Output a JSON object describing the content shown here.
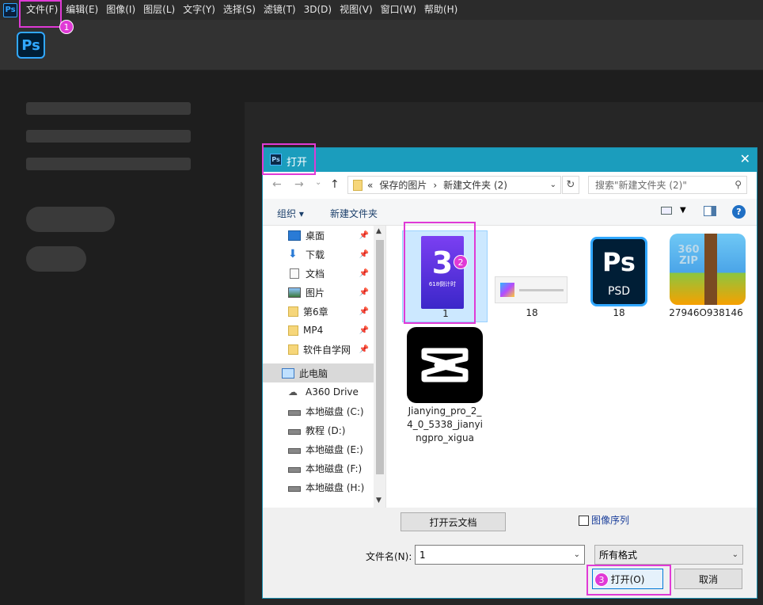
{
  "app": {
    "icon_text": "Ps",
    "menu": [
      "文件(F)",
      "编辑(E)",
      "图像(I)",
      "图层(L)",
      "文字(Y)",
      "选择(S)",
      "滤镜(T)",
      "3D(D)",
      "视图(V)",
      "窗口(W)",
      "帮助(H)"
    ],
    "logo_text": "Ps"
  },
  "dialog": {
    "title": "打开",
    "title_icon": "Ps",
    "close": "✕",
    "nav": {
      "back": "←",
      "forward": "→",
      "dropdown": "⌄",
      "up": "↑"
    },
    "breadcrumb": {
      "prefix": "«",
      "parent": "保存的图片",
      "separator": "›",
      "current": "新建文件夹 (2)"
    },
    "search_placeholder": "搜索\"新建文件夹 (2)\"",
    "organize": "组织 ▾",
    "new_folder": "新建文件夹",
    "help": "?",
    "nav_items": [
      {
        "label": "桌面",
        "icon": "desktop-icon",
        "pinned": true
      },
      {
        "label": "下载",
        "icon": "download-icon",
        "pinned": true
      },
      {
        "label": "文档",
        "icon": "document-icon",
        "pinned": true
      },
      {
        "label": "图片",
        "icon": "picture-icon",
        "pinned": true
      },
      {
        "label": "第6章",
        "icon": "folder-icon",
        "pinned": true
      },
      {
        "label": "MP4",
        "icon": "folder-icon",
        "pinned": true
      },
      {
        "label": "软件自学网",
        "icon": "folder-icon",
        "pinned": true
      },
      {
        "label": "此电脑",
        "icon": "computer-icon",
        "pinned": false
      },
      {
        "label": "A360 Drive",
        "icon": "cloud-drive-icon",
        "pinned": false
      },
      {
        "label": "本地磁盘 (C:)",
        "icon": "drive-icon",
        "pinned": false
      },
      {
        "label": "教程 (D:)",
        "icon": "drive-icon",
        "pinned": false
      },
      {
        "label": "本地磁盘 (E:)",
        "icon": "drive-icon",
        "pinned": false
      },
      {
        "label": "本地磁盘 (F:)",
        "icon": "drive-icon",
        "pinned": false
      },
      {
        "label": "本地磁盘 (H:)",
        "icon": "drive-icon",
        "pinned": false
      }
    ],
    "files": [
      {
        "name": "1",
        "thumb_text": "3",
        "thumb_caption": "618倒计时"
      },
      {
        "name": "18"
      },
      {
        "name": "18",
        "thumb_text": "Ps",
        "thumb_caption": "PSD"
      },
      {
        "name": "27946O938146",
        "thumb_text": "360 ZIP"
      },
      {
        "name_lines": [
          "Jianying_pro_2_",
          "4_0_5338_jianyi",
          "ngpro_xigua"
        ]
      }
    ],
    "open_cloud": "打开云文档",
    "image_sequence": "图像序列",
    "filename_label": "文件名(N):",
    "filename_value": "1",
    "filetype_value": "所有格式",
    "open_button": "打开(O)",
    "cancel_button": "取消"
  },
  "annotations": [
    "1",
    "2",
    "3"
  ],
  "colors": {
    "highlight": "#e03ad6",
    "titlebar": "#1b9dbd",
    "ps_blue": "#31a8ff"
  }
}
